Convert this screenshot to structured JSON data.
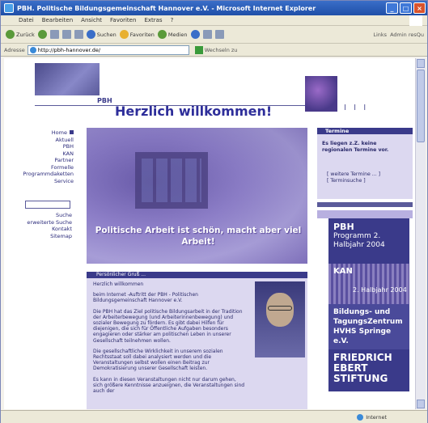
{
  "window": {
    "title": "PBH. Politische Bildungsgemeinschaft Hannover e.V. - Microsoft Internet Explorer"
  },
  "menu": [
    "Datei",
    "Bearbeiten",
    "Ansicht",
    "Favoriten",
    "Extras",
    "?"
  ],
  "toolbar": {
    "back": "Zurück",
    "search": "Suchen",
    "favorites": "Favoriten",
    "media": "Medien",
    "links": "Links",
    "admin": "Admin resQu"
  },
  "address": {
    "label": "Adresse",
    "url": "http://pbh-hannover.de/",
    "go": "Wechseln zu"
  },
  "page": {
    "pbh_small": "PBH",
    "welcome": "Herzlich willkommen!",
    "ticks": "I I I",
    "nav": [
      "Home",
      "Aktuell",
      "PBH",
      "KAN",
      "Partner",
      "Formelle",
      "Programmdaketten",
      "Service"
    ],
    "nav2": [
      "Suche",
      "erweiterte Suche",
      "Kontakt",
      "Sitemap"
    ],
    "hero_caption": "Politische Arbeit ist schön, macht aber viel Arbeit!",
    "greet_head": "Persönlicher Gruß ...",
    "greet_paragraphs": [
      "Herzlich willkommen",
      "beim Internet -Auftritt der PBH - Politischen Bildungsgemeinschaft Hannover e.V.",
      "Die PBH hat das Ziel politische Bildungsarbeit in der Tradition der Arbeiterbewegung (und Arbeiterinnenbewegung) und sozialer Bewegung zu fördern. Es gibt dabei Hilfen für diejenigen, die sich für Öffentliche Aufgaben besonders engagieren oder stärker am politischen Leben in unserer Gesellschaft teilnehmen wollen.",
      "Die gesellschaftliche Wirklichkeit in unserem sozialen Rechtsstaat soll dabei analysiert werden und die Veranstaltungen selbst wollen einen Beitrag zur Demokratisierung unserer Gesellschaft leisten.",
      "Es kann in diesen Veranstaltungen nicht nur darum gehen, sich größere Kenntnisse anzueignen, die Veranstaltungen sind auch der"
    ],
    "termine_head": "Termine",
    "termine_msg": "Es liegen z.Z. keine regionalen Termine vor.",
    "termine_links": [
      "[ weitere Termine ... ]",
      "[ Terminsuche ]"
    ],
    "promo_pbh": "PBH",
    "promo_pbh_sub": "Programm 2. Halbjahr 2004",
    "promo_kan": "KAN",
    "promo_kan_sub": "2. Halbjahr 2004",
    "promo_hvhs": "Bildungs- und TagungsZentrum HVHS Springe e.V.",
    "promo_fes": "FRIEDRICH EBERT STIFTUNG"
  },
  "status": {
    "zone": "Internet"
  }
}
